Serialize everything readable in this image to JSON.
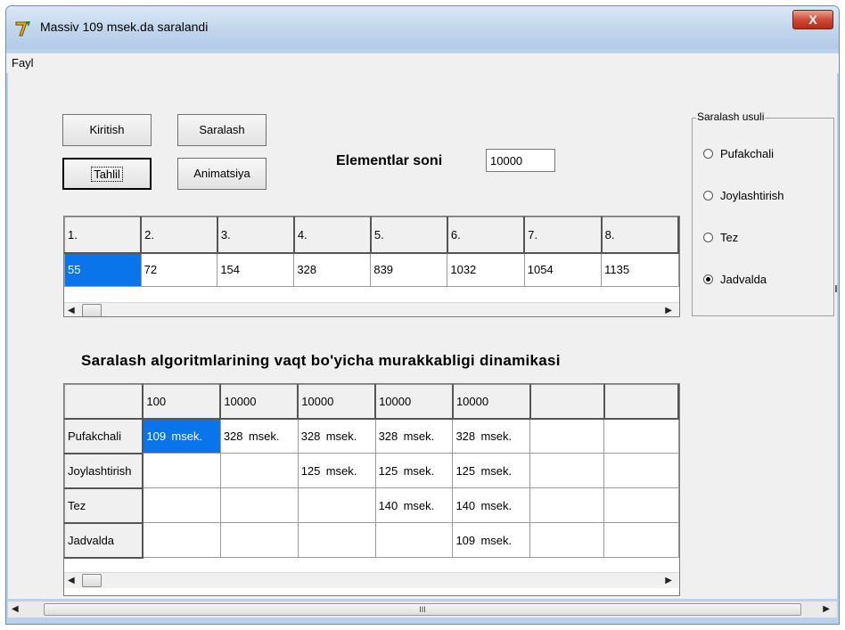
{
  "window": {
    "title": "Massiv  109  msek.da saralandi",
    "close_label": "X"
  },
  "menu": {
    "items": [
      "Fayl"
    ]
  },
  "buttons": {
    "kiritish": "Kiritish",
    "saralash": "Saralash",
    "tahlil": "Tahlil",
    "animatsiya": "Animatsiya"
  },
  "elements": {
    "label": "Elementlar soni",
    "value": "10000"
  },
  "method_group": {
    "title": "Saralash usuli",
    "options": [
      "Pufakchali",
      "Joylashtirish",
      "Tez",
      "Jadvalda"
    ],
    "selected": "Jadvalda"
  },
  "array_grid": {
    "headers": [
      "1.",
      "2.",
      "3.",
      "4.",
      "5.",
      "6.",
      "7.",
      "8."
    ],
    "values": [
      "55",
      "72",
      "154",
      "328",
      "839",
      "1032",
      "1054",
      "1135"
    ],
    "selected_index": 0
  },
  "analysis": {
    "title": "Saralash  algoritmlarining  vaqt bo'yicha murakkabligi  dinamikasi",
    "columns": [
      "",
      "100",
      "10000",
      "10000",
      "10000",
      "10000",
      "",
      ""
    ],
    "rows": [
      {
        "label": "Pufakchali",
        "cells": [
          [
            "109",
            "msek."
          ],
          [
            "328",
            "msek."
          ],
          [
            "328",
            "msek."
          ],
          [
            "328",
            "msek."
          ],
          [
            "328",
            "msek."
          ],
          [
            "",
            ""
          ],
          [
            "",
            ""
          ]
        ]
      },
      {
        "label": "Joylashtirish",
        "cells": [
          [
            "",
            ""
          ],
          [
            "",
            ""
          ],
          [
            "125",
            "msek."
          ],
          [
            "125",
            "msek."
          ],
          [
            "125",
            "msek."
          ],
          [
            "",
            ""
          ],
          [
            "",
            ""
          ]
        ]
      },
      {
        "label": "Tez",
        "cells": [
          [
            "",
            ""
          ],
          [
            "",
            ""
          ],
          [
            "",
            ""
          ],
          [
            "140",
            "msek."
          ],
          [
            "140",
            "msek."
          ],
          [
            "",
            ""
          ],
          [
            "",
            ""
          ]
        ]
      },
      {
        "label": "Jadvalda",
        "cells": [
          [
            "",
            ""
          ],
          [
            "",
            ""
          ],
          [
            "",
            ""
          ],
          [
            "",
            ""
          ],
          [
            "109",
            "msek."
          ],
          [
            "",
            ""
          ],
          [
            "",
            ""
          ]
        ]
      }
    ],
    "selected": [
      0,
      0
    ]
  },
  "icons": {
    "left": "◀",
    "right": "▶",
    "grip": "III"
  }
}
